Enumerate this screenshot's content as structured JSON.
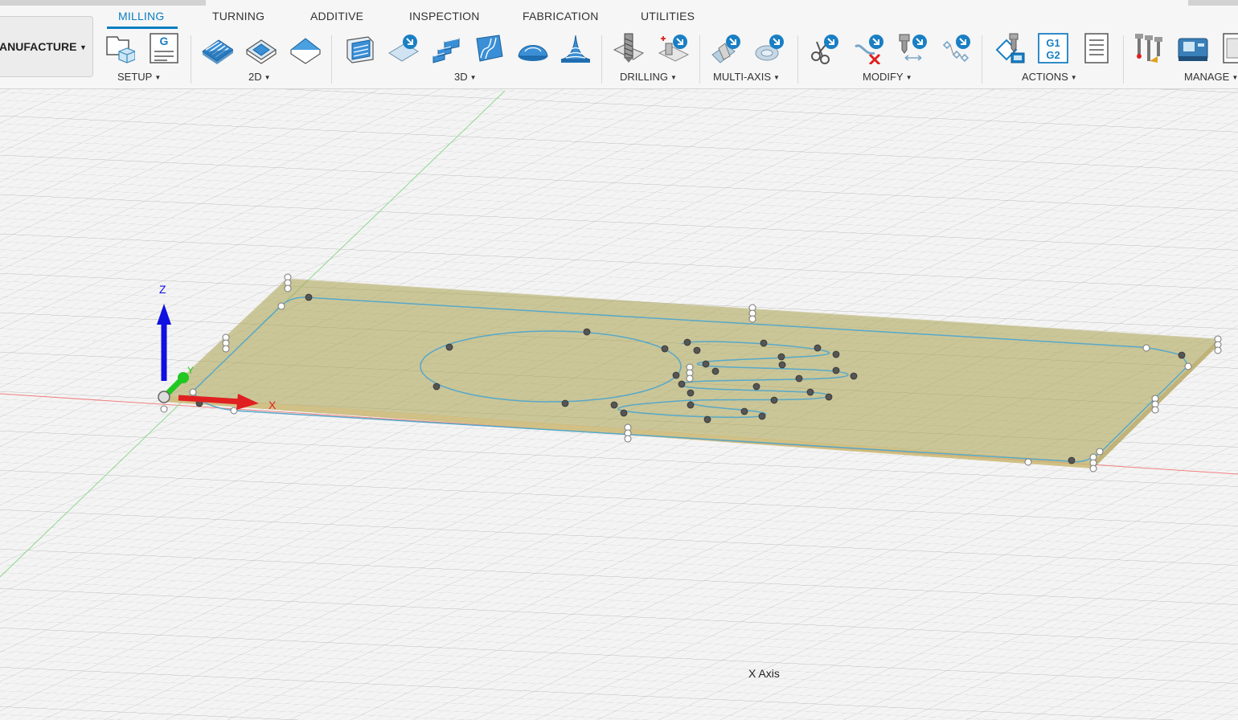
{
  "workspace": {
    "label": "ANUFACTURE"
  },
  "tabs": [
    {
      "label": "MILLING"
    },
    {
      "label": "TURNING"
    },
    {
      "label": "ADDITIVE"
    },
    {
      "label": "INSPECTION"
    },
    {
      "label": "FABRICATION"
    },
    {
      "label": "UTILITIES"
    }
  ],
  "groups": {
    "setup": "SETUP",
    "two_d": "2D",
    "three_d": "3D",
    "drilling": "DRILLING",
    "multi_axis": "MULTI-AXIS",
    "modify": "MODIFY",
    "actions": "ACTIONS",
    "manage": "MANAGE"
  },
  "icons": {
    "setup": [
      "new-setup-icon",
      "nc-program-icon"
    ],
    "two_d": [
      "2d-adaptive-icon",
      "2d-pocket-icon",
      "face-icon"
    ],
    "three_d": [
      "3d-adaptive-icon",
      "3d-pocket-clearing-icon",
      "steep-and-shallow-icon",
      "flow-icon",
      "parallel-icon",
      "scallop-icon"
    ],
    "drilling": [
      "drill-icon",
      "hole-recognition-icon"
    ],
    "multi_axis": [
      "swarf-icon",
      "multi-axis-contour-icon"
    ],
    "modify": [
      "trim-toolpath-icon",
      "delete-toolpath-icon",
      "move-tool-icon",
      "pattern-icon"
    ],
    "actions": [
      "simulate-icon",
      "post-process-icon",
      "setup-sheet-icon"
    ],
    "manage": [
      "tool-library-icon",
      "machine-library-icon",
      "template-library-icon"
    ]
  },
  "nc_program_glyph": "G",
  "post_glyph": [
    "G1",
    "G2"
  ],
  "triad": {
    "z": "Z",
    "y": "Y",
    "x": "X"
  },
  "status": {
    "axis_hint": "X Axis"
  },
  "colors": {
    "accent": "#0a7ec2",
    "plate": "#a8a24e",
    "toolpath": "#58a8c8",
    "x_axis": "#e02020",
    "y_axis": "#22c822",
    "z_axis": "#1010e0"
  }
}
